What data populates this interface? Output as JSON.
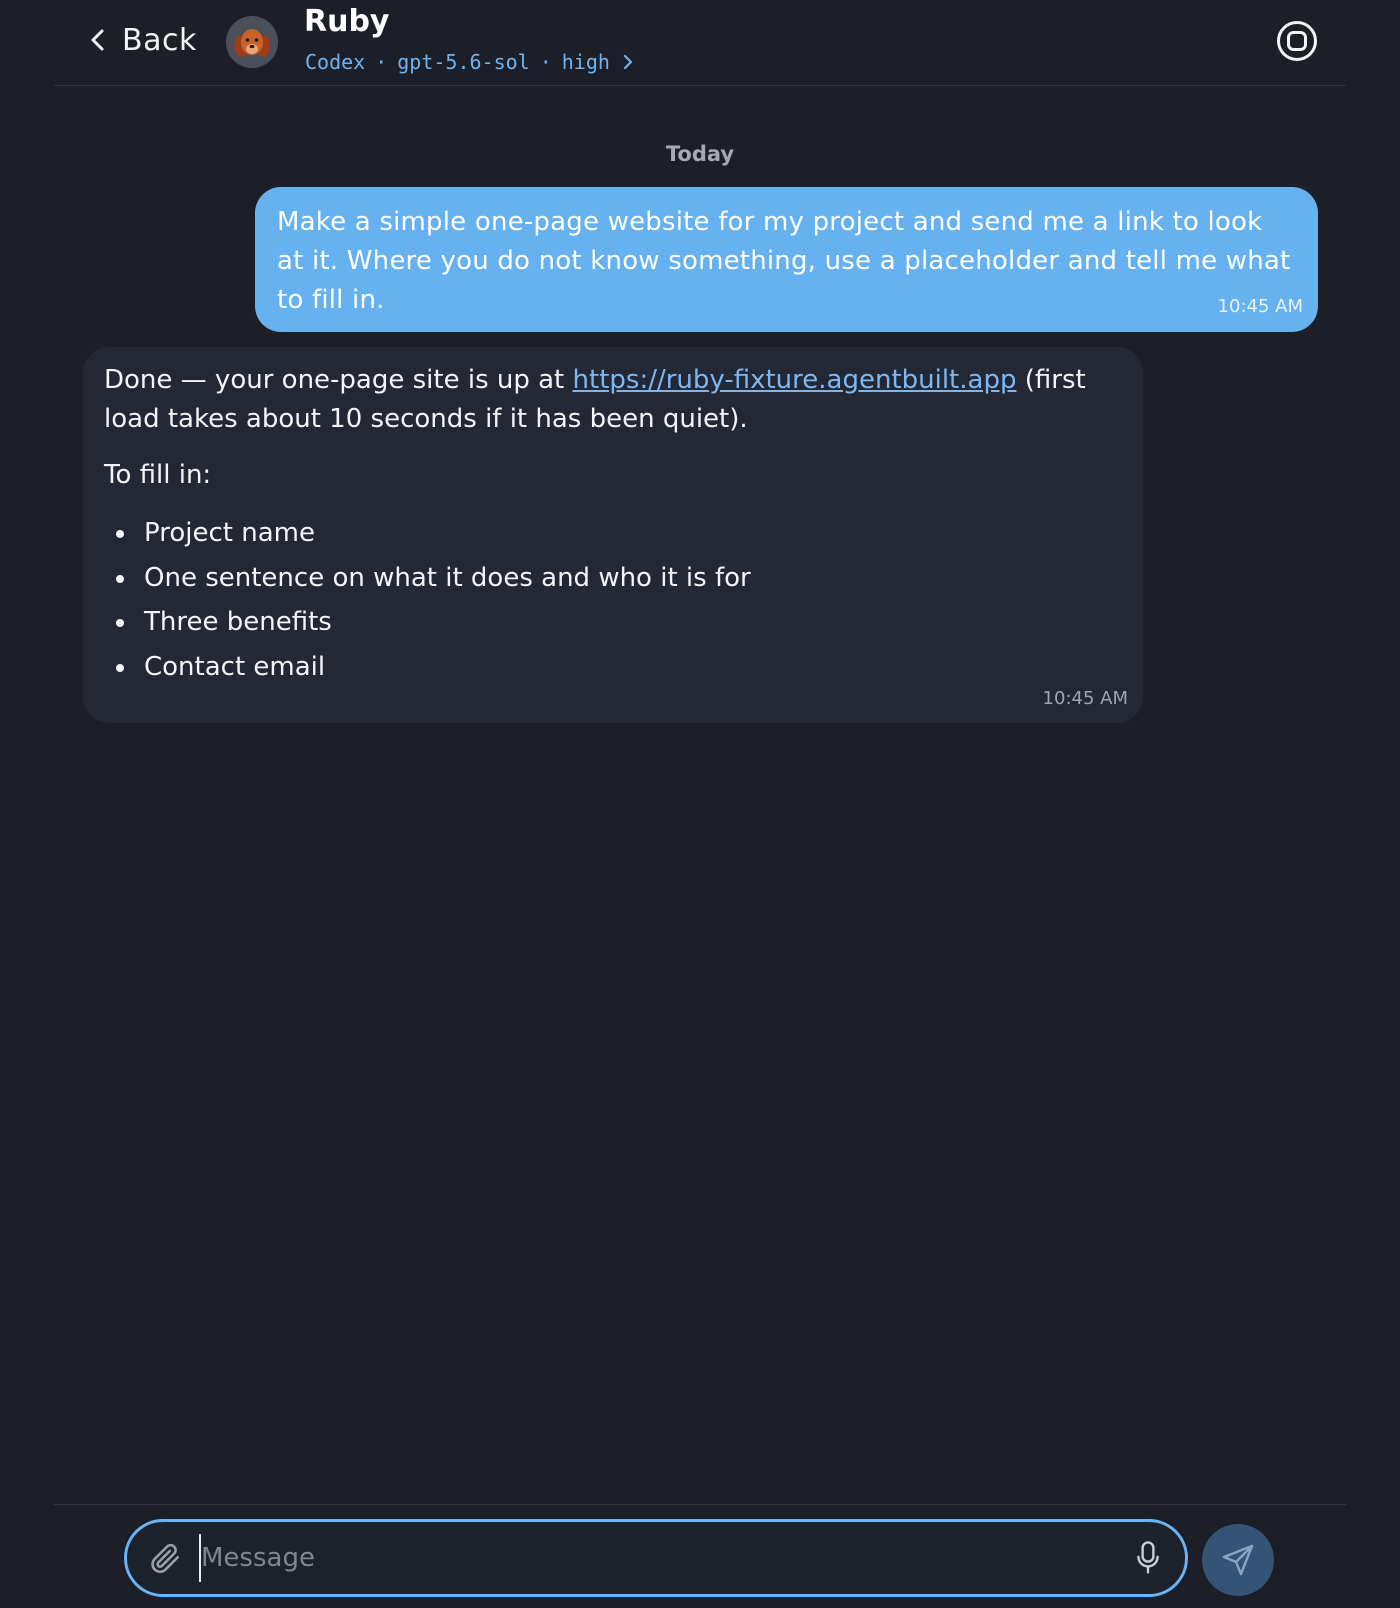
{
  "header": {
    "back_label": "Back",
    "title": "Ruby",
    "subtitle": {
      "provider": "Codex",
      "separator": "·",
      "model": "gpt-5.6-sol",
      "effort": "high"
    }
  },
  "conversation": {
    "date_separator": "Today",
    "messages": [
      {
        "role": "user",
        "text": "Make a simple one-page website for my project and send me a link to look at it. Where you do not know something, use a placeholder and tell me what to fill in.",
        "time": "10:45 AM"
      },
      {
        "role": "agent",
        "intro_before_link": "Done — your one-page site is up at ",
        "link_text": "https://ruby-fixture.agentbuilt.app",
        "intro_after_link": " (first load takes about 10 seconds if it has been quiet).",
        "fill_in_heading": "To fill in:",
        "fill_in_items": [
          "Project name",
          "One sentence on what it does and who it is for",
          "Three benefits",
          "Contact email"
        ],
        "time": "10:45 AM"
      }
    ]
  },
  "composer": {
    "placeholder": "Message",
    "value": ""
  },
  "icons": {
    "back": "chevron-left-icon",
    "avatar": "dog-avatar",
    "subtitle_chevron": "chevron-right-icon",
    "menu": "circle-stop-icon",
    "attach": "paperclip-icon",
    "mic": "microphone-icon",
    "send": "send-icon"
  },
  "colors": {
    "background": "#1c1f27",
    "user_bubble": "#66b1f0",
    "agent_bubble": "#232834",
    "accent": "#6ab4f5",
    "send_button": "#355374"
  }
}
